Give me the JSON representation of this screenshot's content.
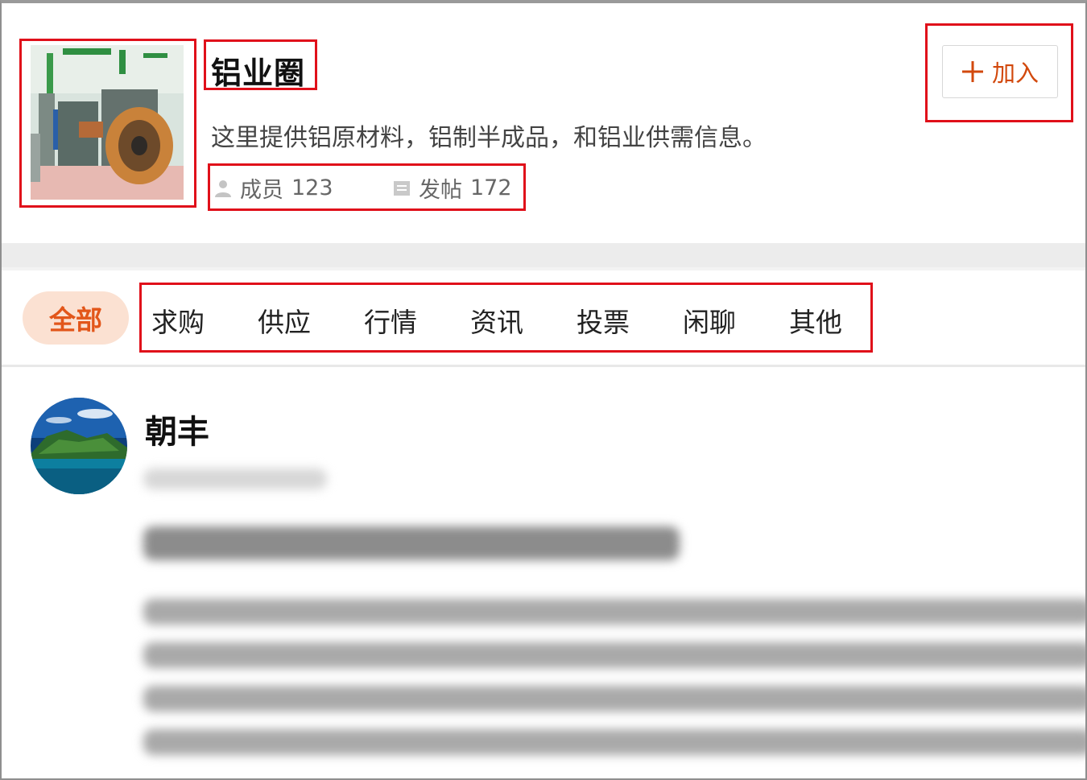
{
  "group": {
    "title": "铝业圈",
    "description": "这里提供铝原材料，铝制半成品，和铝业供需信息。",
    "members_label": "成员",
    "members_count": "123",
    "posts_label": "发帖",
    "posts_count": "172",
    "thumbnail_icon": "factory-photo"
  },
  "join_button": {
    "icon": "plus-icon",
    "label": "加入"
  },
  "tabs": {
    "active": "全部",
    "items": [
      "求购",
      "供应",
      "行情",
      "资讯",
      "投票",
      "闲聊",
      "其他"
    ]
  },
  "post": {
    "author": "朝丰",
    "avatar_icon": "island-landscape-avatar"
  },
  "colors": {
    "accent": "#e2561a",
    "highlight_box": "#e0101a",
    "active_tab_bg": "#fbe1d2"
  }
}
